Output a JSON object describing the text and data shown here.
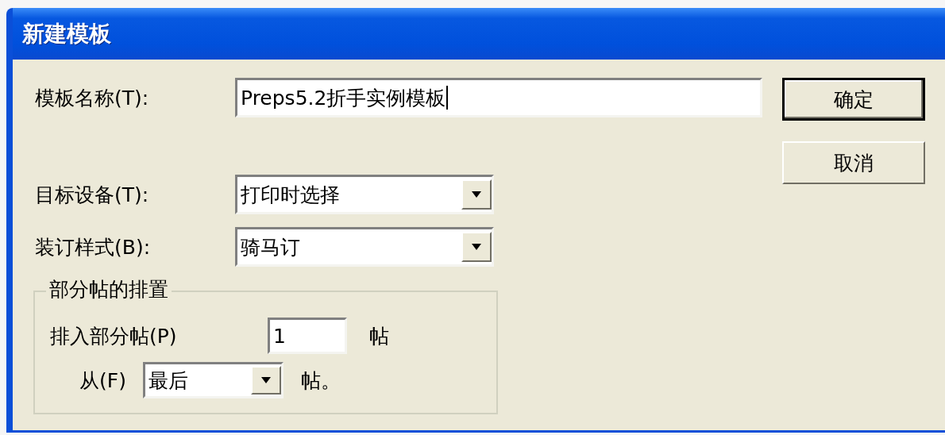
{
  "window": {
    "title": "新建模板"
  },
  "fields": [
    {
      "kind": "text",
      "label": "模板名称(T):",
      "value": "Preps5.2折手实例模板"
    },
    {
      "kind": "combo",
      "label": "目标设备(T):",
      "value": "打印时选择"
    },
    {
      "kind": "combo",
      "label": "装订样式(B):",
      "value": "骑马订"
    }
  ],
  "group": {
    "title": "部分帖的排置",
    "insert": {
      "label": "排入部分帖(P)",
      "value": "1",
      "unit": "帖"
    },
    "from": {
      "label": "从(F)",
      "value": "最后",
      "unit": "帖。"
    }
  },
  "buttons": [
    {
      "label": "确定",
      "default": true
    },
    {
      "label": "取消",
      "default": false
    }
  ]
}
